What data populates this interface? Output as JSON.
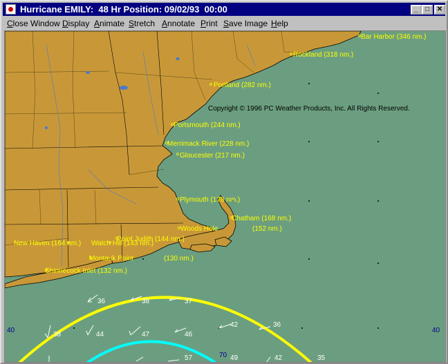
{
  "window": {
    "title": "Hurricane EMILY:  48 Hr Position: 09/02/93  00:00",
    "minimize_label": "_",
    "maximize_label": "□",
    "close_label": "✕"
  },
  "menu": [
    "Close Window",
    "Display",
    "Animate",
    "Stretch",
    "Annotate",
    "Print",
    "Save Image",
    "Help"
  ],
  "map": {
    "copyright": "Copyright © 1996 PC Weather Products, Inc. All Rights Reserved.",
    "colors": {
      "ocean": "#6b9e80",
      "land": "#c89838",
      "labels": "#ffff00",
      "wind": "#ffffff",
      "outer_ring": "#ffff00",
      "inner_ring": "#00ffff",
      "edge_numbers": "#00008b"
    },
    "places": [
      "Bar Harbor (346 nm.)",
      "Rockland (318 nm.)",
      "Portland (282 nm.)",
      "Portsmouth (244 nm.)",
      "Merrimack River (228 nm.)",
      "Gloucester (217 nm.)",
      "Plymouth (178 nm.)",
      "Chatham (168 nm.)",
      "Woods Hole",
      "(152 nm.)",
      "New Haven (164 nm.)",
      "Watch Hill (143 nm.)",
      "Point Judith (144 nm.)",
      "Montauk Point",
      "(130 nm.)",
      "Shinnecock Inlet (132 nm.)"
    ],
    "wind_speeds": [
      "36",
      "38",
      "37",
      "42",
      "36",
      "38",
      "44",
      "47",
      "46",
      "42",
      "57",
      "70",
      "49",
      "42",
      "35"
    ],
    "edge_labels": {
      "left": "40",
      "right": "40"
    }
  }
}
